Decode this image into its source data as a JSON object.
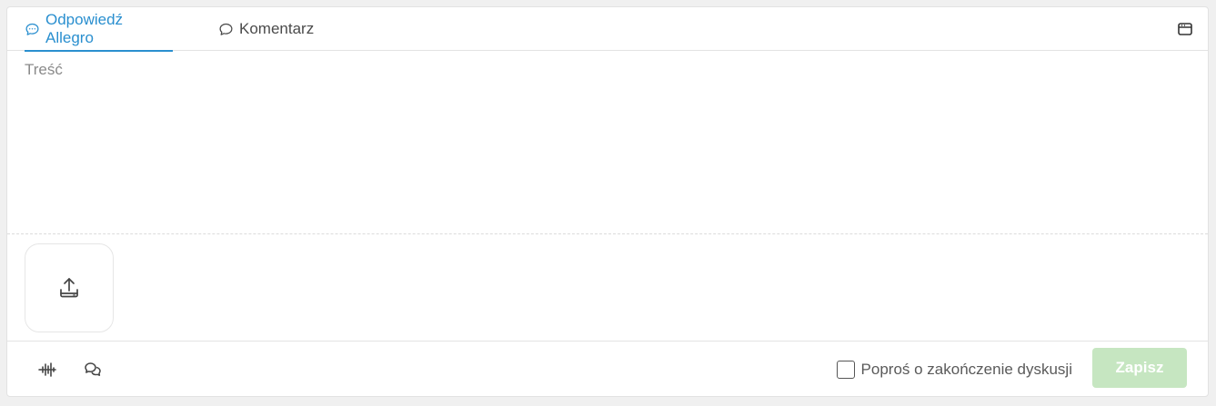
{
  "tabs": [
    {
      "label": "Odpowiedź Allegro",
      "icon": "chat-bubble-dots-icon",
      "active": true
    },
    {
      "label": "Komentarz",
      "icon": "chat-bubble-icon",
      "active": false
    }
  ],
  "editor": {
    "placeholder": "Treść",
    "value": ""
  },
  "footer": {
    "checkbox_label": "Poproś o zakończenie dyskusji",
    "checkbox_checked": false,
    "save_label": "Zapisz"
  },
  "colors": {
    "accent": "#2a8fcf",
    "save_button_disabled": "#c6e6c1"
  }
}
